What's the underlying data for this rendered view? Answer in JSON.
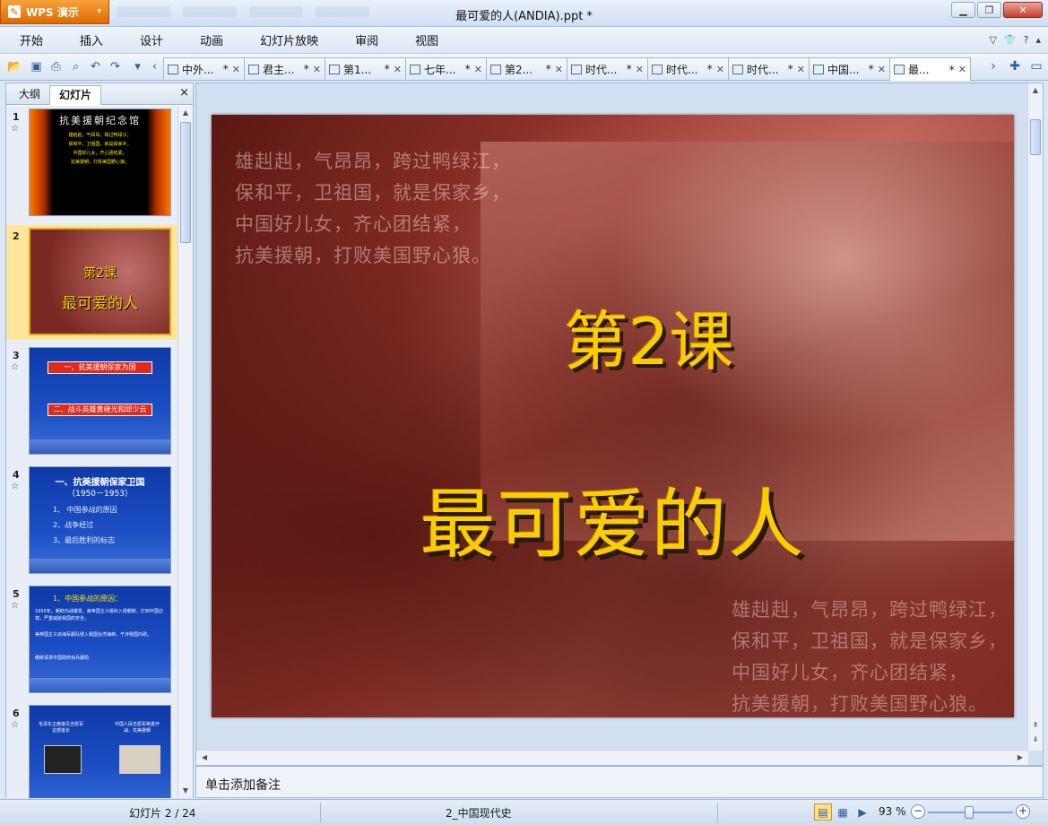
{
  "app": {
    "name": "WPS 演示",
    "window_title": "最可爱的人(ANDIA).ppt *"
  },
  "menu": [
    "开始",
    "插入",
    "设计",
    "动画",
    "幻灯片放映",
    "审阅",
    "视图"
  ],
  "doc_tabs": [
    {
      "label": "中外...",
      "modified": "*"
    },
    {
      "label": "君主...",
      "modified": "*"
    },
    {
      "label": "第1...",
      "modified": "*"
    },
    {
      "label": "七年...",
      "modified": "*"
    },
    {
      "label": "第2...",
      "modified": "*"
    },
    {
      "label": "时代...",
      "modified": "*"
    },
    {
      "label": "时代...",
      "modified": "*"
    },
    {
      "label": "时代...",
      "modified": "*"
    },
    {
      "label": "中国...",
      "modified": "*"
    },
    {
      "label": "最...",
      "modified": "*"
    }
  ],
  "left_panel": {
    "tabs": [
      "大纲",
      "幻灯片"
    ],
    "active_tab": "幻灯片",
    "close": "×"
  },
  "thumbnails": [
    {
      "num": "1",
      "title": "抗美援朝纪念馆",
      "lines": [
        "雄赳赳，气昂昂，跨过鸭绿江。",
        "保和平，卫祖国，就是保家乡。",
        "中国好儿女，齐心团结紧，",
        "抗美援朝，打败美国野心狼。"
      ]
    },
    {
      "num": "2",
      "line1": "第2课",
      "line2": "最可爱的人"
    },
    {
      "num": "3",
      "bar1": "一、抗美援朝保家为国",
      "bar2": "二、战斗英雄黄继光和邱少云"
    },
    {
      "num": "4",
      "h1": "一、抗美援朝保家卫国",
      "h2": "（1950－1953）",
      "items": [
        "1、 中国参战的原因",
        "2、战争经过",
        "3、最后胜利的标志"
      ]
    },
    {
      "num": "5",
      "h": "1、中国参战的原因：",
      "p": [
        "1950年，朝鲜内战爆发，美帝国主义组织入侵朝鲜，打到中国边境，严重威胁我国的安全。",
        "美帝国主义派海军舰队侵入我国台湾海峡，干涉我国内政。",
        "朝鲜请求中国政府派兵援助"
      ]
    },
    {
      "num": "6",
      "p1": "毛泽东主席接见志愿军总部首长",
      "p2": "中国人民志愿军英勇作战，抗美援朝"
    }
  ],
  "slide": {
    "lesson": "第2课",
    "title": "最可爱的人",
    "poem": [
      "雄赳赳，气昂昂，跨过鸭绿江，",
      "保和平，卫祖国，就是保家乡，",
      "中国好儿女，齐心团结紧，",
      "抗美援朝，打败美国野心狼。"
    ]
  },
  "notes_placeholder": "单击添加备注",
  "status": {
    "slide_info": "幻灯片 2 / 24",
    "template": "2_中国现代史",
    "zoom": "93 %"
  },
  "zoom_level": 0.93,
  "colors": {
    "accent": "#e06a00",
    "title_gold": "#ffcc00",
    "chrome_blue": "#dbe7f5"
  }
}
